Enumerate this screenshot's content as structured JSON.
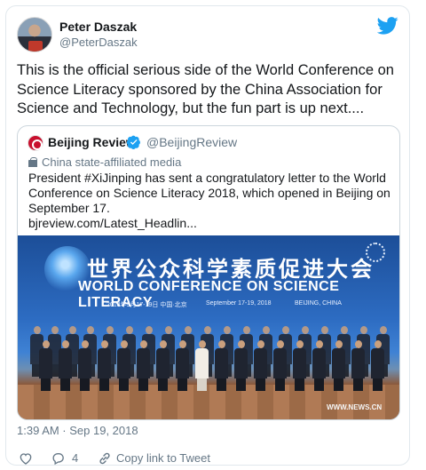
{
  "author": {
    "name": "Peter Daszak",
    "handle": "@PeterDaszak"
  },
  "tweet": {
    "text": "This is the official serious side of the World Conference on Science Literacy sponsored by the China Association for Science and Technology, but the fun part is up next....",
    "timestamp": "1:39 AM · Sep 19, 2018"
  },
  "quoted": {
    "name": "Beijing Review",
    "handle": "@BeijingReview",
    "label": "China state-affiliated media",
    "text": "President #XiJinping has sent a congratulatory letter to the World Conference on Science Literacy 2018, which opened in Beijing on September 17.",
    "link": "bjreview.com/Latest_Headlin...",
    "photo": {
      "banner_cn": "世界公众科学素质促进大会",
      "banner_en": "WORLD CONFERENCE ON SCIENCE LITERACY",
      "banner_date_cn": "2018年9月17-19日  中国·北京",
      "banner_date_en": "September 17-19, 2018",
      "banner_city": "BEIJING, CHINA",
      "watermark": "WWW.NEWS.CN"
    }
  },
  "actions": {
    "reply_count": "4",
    "copy_link_label": "Copy link to Tweet"
  },
  "colors": {
    "twitter_blue": "#1da1f2",
    "secondary_text": "#657786",
    "border": "#e1e8ed"
  },
  "icons": [
    "twitter-bird-icon",
    "verified-badge-icon",
    "state-media-flag-icon",
    "heart-icon",
    "reply-icon",
    "link-icon"
  ]
}
